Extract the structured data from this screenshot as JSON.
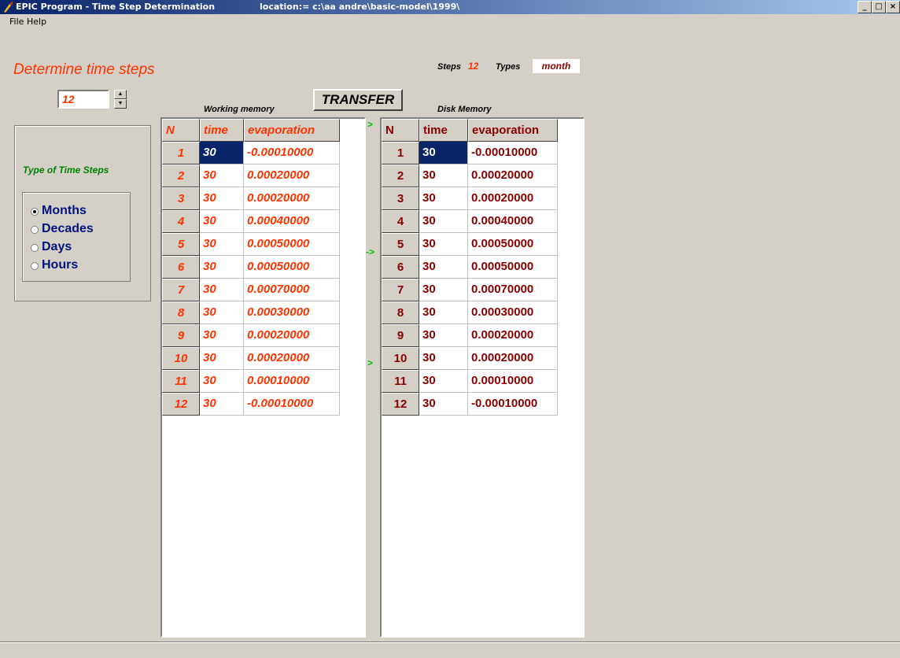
{
  "window": {
    "title": "EPIC Program - Time Step Determination",
    "location": "location:= c:\\aa andre\\basic-model\\1999\\",
    "min_glyph": "_",
    "max_glyph": "□",
    "close_glyph": "×"
  },
  "menu": {
    "file": "File",
    "help": "Help"
  },
  "determine": {
    "title": "Determine time steps",
    "spin_value": "12"
  },
  "group": {
    "title": "Type of Time Steps",
    "options": [
      "Months",
      "Decades",
      "Days",
      "Hours"
    ],
    "selected": "Months"
  },
  "summary": {
    "steps_label": "Steps",
    "steps_value": "12",
    "types_label": "Types",
    "types_value": "month"
  },
  "transfer_label": "TRANSFER",
  "working_memory": {
    "label": "Working memory",
    "headers": [
      "N",
      "time",
      "evaporation"
    ],
    "rows": [
      [
        "1",
        "30",
        "-0.00010000"
      ],
      [
        "2",
        "30",
        "0.00020000"
      ],
      [
        "3",
        "30",
        "0.00020000"
      ],
      [
        "4",
        "30",
        "0.00040000"
      ],
      [
        "5",
        "30",
        "0.00050000"
      ],
      [
        "6",
        "30",
        "0.00050000"
      ],
      [
        "7",
        "30",
        "0.00070000"
      ],
      [
        "8",
        "30",
        "0.00030000"
      ],
      [
        "9",
        "30",
        "0.00020000"
      ],
      [
        "10",
        "30",
        "0.00020000"
      ],
      [
        "11",
        "30",
        "0.00010000"
      ],
      [
        "12",
        "30",
        "-0.00010000"
      ]
    ]
  },
  "disk_memory": {
    "label": "Disk Memory",
    "headers": [
      "N",
      "time",
      "evaporation"
    ],
    "rows": [
      [
        "1",
        "30",
        "-0.00010000"
      ],
      [
        "2",
        "30",
        "0.00020000"
      ],
      [
        "3",
        "30",
        "0.00020000"
      ],
      [
        "4",
        "30",
        "0.00040000"
      ],
      [
        "5",
        "30",
        "0.00050000"
      ],
      [
        "6",
        "30",
        "0.00050000"
      ],
      [
        "7",
        "30",
        "0.00070000"
      ],
      [
        "8",
        "30",
        "0.00030000"
      ],
      [
        "9",
        "30",
        "0.00020000"
      ],
      [
        "10",
        "30",
        "0.00020000"
      ],
      [
        "11",
        "30",
        "0.00010000"
      ],
      [
        "12",
        "30",
        "-0.00010000"
      ]
    ]
  },
  "arrows": [
    ">",
    "->",
    ">"
  ],
  "colors": {
    "accent_red": "#ff3300",
    "dark_red": "#8b0000",
    "selection": "#0a246a",
    "group_green": "#008000",
    "radio_blue": "#00137f",
    "arrow_green": "#00c000"
  }
}
